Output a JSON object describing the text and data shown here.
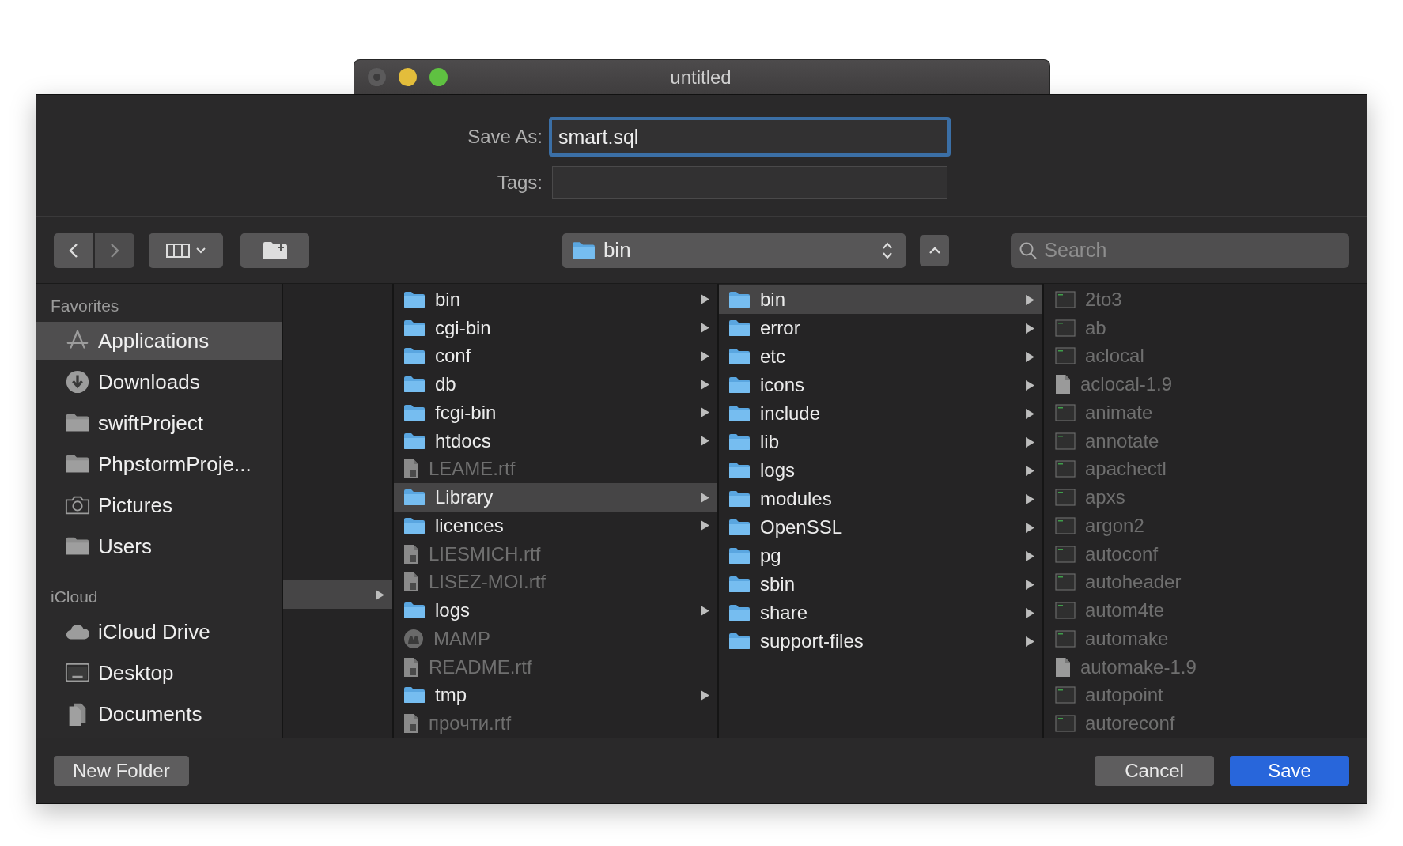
{
  "window": {
    "title": "untitled"
  },
  "save_as": {
    "label": "Save As:",
    "value": "smart.sql",
    "focused": true
  },
  "tags": {
    "label": "Tags:"
  },
  "toolbar": {
    "location": "bin",
    "search": {
      "placeholder": "Search"
    }
  },
  "sidebar": {
    "sections": [
      {
        "title": "Favorites",
        "items": [
          {
            "label": "Applications",
            "kind": "apps",
            "selected": true
          },
          {
            "label": "Downloads",
            "kind": "download",
            "selected": false
          },
          {
            "label": "swiftProject",
            "kind": "folder",
            "selected": false
          },
          {
            "label": "PhpstormProje...",
            "kind": "folder",
            "selected": false
          },
          {
            "label": "Pictures",
            "kind": "camera",
            "selected": false
          },
          {
            "label": "Users",
            "kind": "folder",
            "selected": false
          }
        ]
      },
      {
        "title": "iCloud",
        "items": [
          {
            "label": "iCloud Drive",
            "kind": "cloud",
            "selected": false
          },
          {
            "label": "Desktop",
            "kind": "desktop",
            "selected": false
          },
          {
            "label": "Documents",
            "kind": "docs",
            "selected": false
          }
        ]
      }
    ]
  },
  "columns": [
    {
      "kind": "scrolled",
      "items": [
        {
          "kind": "blank",
          "selected": true,
          "expandable": true
        }
      ]
    },
    {
      "kind": "list",
      "items": [
        {
          "label": "bin",
          "kind": "folder",
          "selected": false,
          "expandable": true,
          "disabled": false
        },
        {
          "label": "cgi-bin",
          "kind": "folder",
          "selected": false,
          "expandable": true,
          "disabled": false
        },
        {
          "label": "conf",
          "kind": "folder",
          "selected": false,
          "expandable": true,
          "disabled": false
        },
        {
          "label": "db",
          "kind": "folder",
          "selected": false,
          "expandable": true,
          "disabled": false
        },
        {
          "label": "fcgi-bin",
          "kind": "folder",
          "selected": false,
          "expandable": true,
          "disabled": false
        },
        {
          "label": "htdocs",
          "kind": "folder",
          "selected": false,
          "expandable": true,
          "disabled": false
        },
        {
          "label": "LEAME.rtf",
          "kind": "document",
          "selected": false,
          "expandable": false,
          "disabled": true
        },
        {
          "label": "Library",
          "kind": "folder",
          "selected": true,
          "expandable": true,
          "disabled": false
        },
        {
          "label": "licences",
          "kind": "folder",
          "selected": false,
          "expandable": true,
          "disabled": false
        },
        {
          "label": "LIESMICH.rtf",
          "kind": "document",
          "selected": false,
          "expandable": false,
          "disabled": true
        },
        {
          "label": "LISEZ-MOI.rtf",
          "kind": "document",
          "selected": false,
          "expandable": false,
          "disabled": true
        },
        {
          "label": "logs",
          "kind": "folder",
          "selected": false,
          "expandable": true,
          "disabled": false
        },
        {
          "label": "MAMP",
          "kind": "app",
          "selected": false,
          "expandable": false,
          "disabled": true
        },
        {
          "label": "README.rtf",
          "kind": "document",
          "selected": false,
          "expandable": false,
          "disabled": true
        },
        {
          "label": "tmp",
          "kind": "folder",
          "selected": false,
          "expandable": true,
          "disabled": false
        },
        {
          "label": "прочти.rtf",
          "kind": "document",
          "selected": false,
          "expandable": false,
          "disabled": true
        }
      ]
    },
    {
      "kind": "list",
      "items": [
        {
          "label": "bin",
          "kind": "folder",
          "selected": true,
          "expandable": true,
          "disabled": false
        },
        {
          "label": "error",
          "kind": "folder",
          "selected": false,
          "expandable": true,
          "disabled": false
        },
        {
          "label": "etc",
          "kind": "folder",
          "selected": false,
          "expandable": true,
          "disabled": false
        },
        {
          "label": "icons",
          "kind": "folder",
          "selected": false,
          "expandable": true,
          "disabled": false
        },
        {
          "label": "include",
          "kind": "folder",
          "selected": false,
          "expandable": true,
          "disabled": false
        },
        {
          "label": "lib",
          "kind": "folder",
          "selected": false,
          "expandable": true,
          "disabled": false
        },
        {
          "label": "logs",
          "kind": "folder",
          "selected": false,
          "expandable": true,
          "disabled": false
        },
        {
          "label": "modules",
          "kind": "folder",
          "selected": false,
          "expandable": true,
          "disabled": false
        },
        {
          "label": "OpenSSL",
          "kind": "folder",
          "selected": false,
          "expandable": true,
          "disabled": false
        },
        {
          "label": "pg",
          "kind": "folder",
          "selected": false,
          "expandable": true,
          "disabled": false
        },
        {
          "label": "sbin",
          "kind": "folder",
          "selected": false,
          "expandable": true,
          "disabled": false
        },
        {
          "label": "share",
          "kind": "folder",
          "selected": false,
          "expandable": true,
          "disabled": false
        },
        {
          "label": "support-files",
          "kind": "folder",
          "selected": false,
          "expandable": true,
          "disabled": false
        }
      ]
    },
    {
      "kind": "list",
      "items": [
        {
          "label": "2to3",
          "kind": "executable",
          "selected": false,
          "expandable": false,
          "disabled": true
        },
        {
          "label": "ab",
          "kind": "executable",
          "selected": false,
          "expandable": false,
          "disabled": true
        },
        {
          "label": "aclocal",
          "kind": "executable",
          "selected": false,
          "expandable": false,
          "disabled": true
        },
        {
          "label": "aclocal-1.9",
          "kind": "file",
          "selected": false,
          "expandable": false,
          "disabled": true
        },
        {
          "label": "animate",
          "kind": "executable",
          "selected": false,
          "expandable": false,
          "disabled": true
        },
        {
          "label": "annotate",
          "kind": "executable",
          "selected": false,
          "expandable": false,
          "disabled": true
        },
        {
          "label": "apachectl",
          "kind": "executable",
          "selected": false,
          "expandable": false,
          "disabled": true
        },
        {
          "label": "apxs",
          "kind": "executable",
          "selected": false,
          "expandable": false,
          "disabled": true
        },
        {
          "label": "argon2",
          "kind": "executable",
          "selected": false,
          "expandable": false,
          "disabled": true
        },
        {
          "label": "autoconf",
          "kind": "executable",
          "selected": false,
          "expandable": false,
          "disabled": true
        },
        {
          "label": "autoheader",
          "kind": "executable",
          "selected": false,
          "expandable": false,
          "disabled": true
        },
        {
          "label": "autom4te",
          "kind": "executable",
          "selected": false,
          "expandable": false,
          "disabled": true
        },
        {
          "label": "automake",
          "kind": "executable",
          "selected": false,
          "expandable": false,
          "disabled": true
        },
        {
          "label": "automake-1.9",
          "kind": "file",
          "selected": false,
          "expandable": false,
          "disabled": true
        },
        {
          "label": "autopoint",
          "kind": "executable",
          "selected": false,
          "expandable": false,
          "disabled": true
        },
        {
          "label": "autoreconf",
          "kind": "executable",
          "selected": false,
          "expandable": false,
          "disabled": true
        }
      ]
    }
  ],
  "buttons": {
    "new_folder": "New Folder",
    "cancel": "Cancel",
    "save": "Save"
  }
}
